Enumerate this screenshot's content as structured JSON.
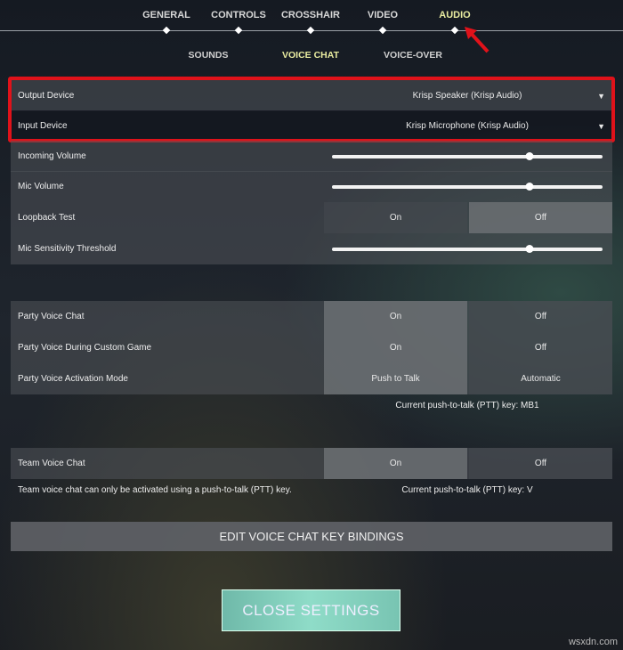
{
  "top_tabs": [
    {
      "label": "GENERAL"
    },
    {
      "label": "CONTROLS"
    },
    {
      "label": "CROSSHAIR"
    },
    {
      "label": "VIDEO"
    },
    {
      "label": "AUDIO",
      "active": true
    }
  ],
  "sub_tabs": [
    {
      "label": "SOUNDS"
    },
    {
      "label": "VOICE CHAT",
      "active": true
    },
    {
      "label": "VOICE-OVER"
    }
  ],
  "devices": {
    "output": {
      "label": "Output Device",
      "value": "Krisp Speaker (Krisp Audio)"
    },
    "input": {
      "label": "Input Device",
      "value": "Krisp Microphone (Krisp Audio)"
    }
  },
  "sliders": {
    "incoming": {
      "label": "Incoming Volume",
      "level": 0.73
    },
    "mic": {
      "label": "Mic Volume",
      "level": 0.73
    },
    "sensitivity": {
      "label": "Mic Sensitivity Threshold",
      "level": 0.73
    }
  },
  "loopback": {
    "label": "Loopback Test",
    "on": "On",
    "off": "Off",
    "selected": "Off"
  },
  "party": {
    "voice_chat": {
      "label": "Party Voice Chat",
      "on": "On",
      "off": "Off",
      "selected": "On"
    },
    "custom_game": {
      "label": "Party Voice During Custom Game",
      "on": "On",
      "off": "Off",
      "selected": "On"
    },
    "activation": {
      "label": "Party Voice Activation Mode",
      "a": "Push to Talk",
      "b": "Automatic",
      "selected": "Push to Talk"
    },
    "ptt_note": "Current push-to-talk (PTT) key: MB1"
  },
  "team": {
    "label": "Team Voice Chat",
    "on": "On",
    "off": "Off",
    "selected": "On",
    "note": "Team voice chat can only be activated using a push-to-talk (PTT) key.",
    "ptt_note": "Current push-to-talk (PTT) key: V"
  },
  "buttons": {
    "edit": "EDIT VOICE CHAT KEY BINDINGS",
    "close": "CLOSE SETTINGS"
  },
  "colors": {
    "highlight": "#e0121a",
    "active_tab": "#e9eca0",
    "close_button": "#8fdcc8"
  },
  "watermark": "wsxdn.com"
}
